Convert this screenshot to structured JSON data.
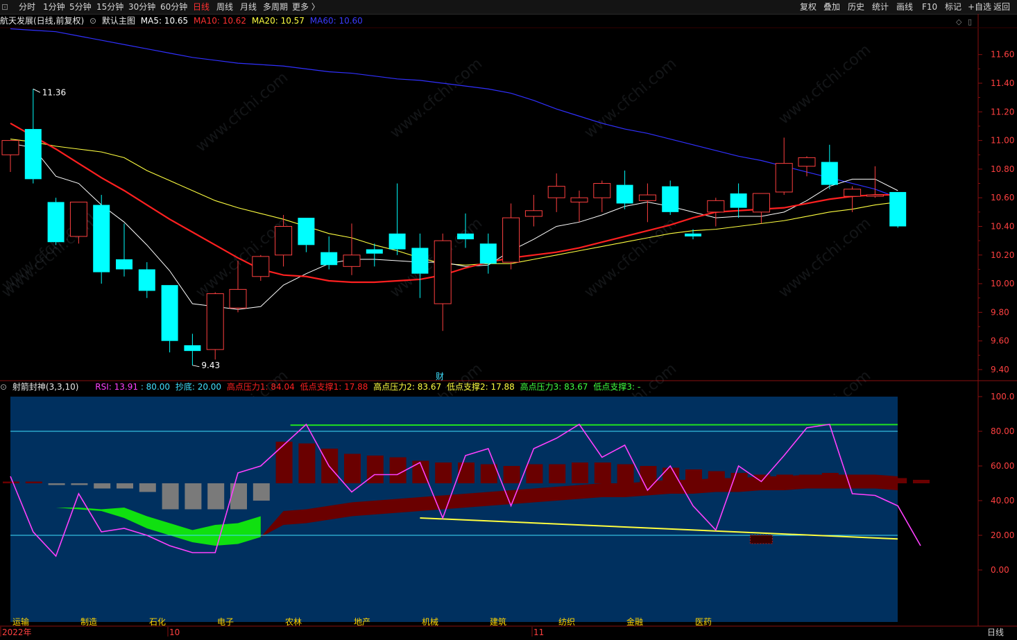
{
  "toolbar": {
    "left": [
      "分时",
      "1分钟",
      "5分钟",
      "15分钟",
      "30分钟",
      "60分钟",
      "日线",
      "周线",
      "月线",
      "多周期",
      "更多 〉"
    ],
    "active": "日线",
    "right": [
      "复权",
      "叠加",
      "历史",
      "统计",
      "画线",
      "F10",
      "标记",
      "+自选",
      "返回"
    ]
  },
  "main": {
    "stock": "航天发展(日线,前复权)",
    "template": "默认主图",
    "ma5": "MA5: 10.65",
    "ma10": "MA10: 10.62",
    "ma20": "MA20: 10.57",
    "ma60": "MA60: 10.60",
    "high_label": "11.36",
    "low_label": "9.43",
    "finance_marker": "财"
  },
  "sub": {
    "name": "射箭封神(3,3,10)",
    "rsi": "RSI: 13.91",
    "v80": ": 80.00",
    "chaodi": "抄底: 20.00",
    "gy1": "高点压力1: 84.04",
    "dz1": "低点支撑1: 17.88",
    "gy2": "高点压力2: 83.67",
    "dz2": "低点支撑2: 17.88",
    "gy3": "高点压力3: 83.67",
    "dz3": "低点支撑3: -"
  },
  "sectors": [
    "运输",
    "制造",
    "石化",
    "电子",
    "农林",
    "地产",
    "机械",
    "建筑",
    "纺织",
    "金融",
    "医药"
  ],
  "time_axis": [
    "2022年",
    "10",
    "11"
  ],
  "period_label": "日线",
  "watermark": "www.cfchi.com",
  "colors": {
    "up": "#ff4040",
    "down": "#00ffff",
    "ma5": "#ffffff",
    "ma10": "#ff2020",
    "ma20": "#ffff40",
    "ma60": "#3030ff",
    "rsi": "#ff40ff",
    "subbg": "#00305f"
  },
  "chart_data": [
    {
      "type": "candlestick",
      "title": "航天发展(日线,前复权)",
      "y_ticks": [
        "11.60",
        "11.40",
        "11.20",
        "11.00",
        "10.80",
        "10.60",
        "10.40",
        "10.20",
        "10.00",
        "9.80",
        "9.60",
        "9.40"
      ],
      "ylim": [
        9.37,
        11.85
      ],
      "candles": [
        {
          "o": 10.9,
          "h": 11.0,
          "l": 10.78,
          "c": 11.0
        },
        {
          "o": 11.08,
          "h": 11.36,
          "l": 10.7,
          "c": 10.73
        },
        {
          "o": 10.57,
          "h": 10.6,
          "l": 10.27,
          "c": 10.29
        },
        {
          "o": 10.33,
          "h": 10.57,
          "l": 10.28,
          "c": 10.57
        },
        {
          "o": 10.55,
          "h": 10.62,
          "l": 10.0,
          "c": 10.08
        },
        {
          "o": 10.17,
          "h": 10.42,
          "l": 10.05,
          "c": 10.1
        },
        {
          "o": 10.1,
          "h": 10.15,
          "l": 9.9,
          "c": 9.95
        },
        {
          "o": 9.99,
          "h": 9.99,
          "l": 9.52,
          "c": 9.6
        },
        {
          "o": 9.57,
          "h": 9.65,
          "l": 9.43,
          "c": 9.53
        },
        {
          "o": 9.54,
          "h": 9.94,
          "l": 9.47,
          "c": 9.93
        },
        {
          "o": 9.83,
          "h": 10.16,
          "l": 9.8,
          "c": 9.96
        },
        {
          "o": 10.05,
          "h": 10.2,
          "l": 10.02,
          "c": 10.19
        },
        {
          "o": 10.2,
          "h": 10.48,
          "l": 10.12,
          "c": 10.4
        },
        {
          "o": 10.46,
          "h": 10.46,
          "l": 10.22,
          "c": 10.27
        },
        {
          "o": 10.22,
          "h": 10.33,
          "l": 10.1,
          "c": 10.13
        },
        {
          "o": 10.12,
          "h": 10.42,
          "l": 10.06,
          "c": 10.2
        },
        {
          "o": 10.24,
          "h": 10.28,
          "l": 10.12,
          "c": 10.21
        },
        {
          "o": 10.35,
          "h": 10.7,
          "l": 10.2,
          "c": 10.24
        },
        {
          "o": 10.25,
          "h": 10.35,
          "l": 9.9,
          "c": 10.07
        },
        {
          "o": 9.86,
          "h": 10.35,
          "l": 9.67,
          "c": 10.3
        },
        {
          "o": 10.35,
          "h": 10.49,
          "l": 10.25,
          "c": 10.31
        },
        {
          "o": 10.28,
          "h": 10.35,
          "l": 10.07,
          "c": 10.14
        },
        {
          "o": 10.15,
          "h": 10.56,
          "l": 10.1,
          "c": 10.46
        },
        {
          "o": 10.47,
          "h": 10.62,
          "l": 10.4,
          "c": 10.51
        },
        {
          "o": 10.6,
          "h": 10.77,
          "l": 10.5,
          "c": 10.68
        },
        {
          "o": 10.57,
          "h": 10.65,
          "l": 10.43,
          "c": 10.6
        },
        {
          "o": 10.6,
          "h": 10.72,
          "l": 10.5,
          "c": 10.7
        },
        {
          "o": 10.69,
          "h": 10.79,
          "l": 10.52,
          "c": 10.56
        },
        {
          "o": 10.58,
          "h": 10.7,
          "l": 10.43,
          "c": 10.62
        },
        {
          "o": 10.68,
          "h": 10.72,
          "l": 10.48,
          "c": 10.5
        },
        {
          "o": 10.35,
          "h": 10.38,
          "l": 10.31,
          "c": 10.33
        },
        {
          "o": 10.5,
          "h": 10.6,
          "l": 10.4,
          "c": 10.58
        },
        {
          "o": 10.63,
          "h": 10.7,
          "l": 10.46,
          "c": 10.53
        },
        {
          "o": 10.5,
          "h": 10.63,
          "l": 10.42,
          "c": 10.63
        },
        {
          "o": 10.64,
          "h": 11.02,
          "l": 10.62,
          "c": 10.84
        },
        {
          "o": 10.82,
          "h": 10.89,
          "l": 10.75,
          "c": 10.88
        },
        {
          "o": 10.85,
          "h": 10.97,
          "l": 10.66,
          "c": 10.69
        },
        {
          "o": 10.61,
          "h": 10.68,
          "l": 10.5,
          "c": 10.66
        },
        {
          "o": 10.62,
          "h": 10.82,
          "l": 10.6,
          "c": 10.62
        },
        {
          "o": 10.64,
          "h": 10.64,
          "l": 10.39,
          "c": 10.4
        }
      ],
      "ma5": [
        10.98,
        10.95,
        10.75,
        10.7,
        10.55,
        10.43,
        10.27,
        10.09,
        9.86,
        9.84,
        9.82,
        9.84,
        9.99,
        10.07,
        10.14,
        10.17,
        10.17,
        10.16,
        10.15,
        10.15,
        10.12,
        10.13,
        10.23,
        10.31,
        10.4,
        10.43,
        10.48,
        10.54,
        10.57,
        10.54,
        10.5,
        10.46,
        10.47,
        10.47,
        10.5,
        10.58,
        10.68,
        10.73,
        10.73,
        10.65
      ],
      "ma10": [
        11.12,
        11.03,
        10.94,
        10.84,
        10.74,
        10.65,
        10.55,
        10.45,
        10.36,
        10.27,
        10.18,
        10.1,
        10.06,
        10.05,
        10.02,
        10.01,
        10.01,
        10.02,
        10.03,
        10.06,
        10.11,
        10.15,
        10.18,
        10.2,
        10.22,
        10.25,
        10.29,
        10.33,
        10.37,
        10.41,
        10.46,
        10.5,
        10.51,
        10.52,
        10.53,
        10.56,
        10.59,
        10.61,
        10.62,
        10.62
      ],
      "ma20": [
        11.01,
        10.99,
        10.96,
        10.94,
        10.92,
        10.88,
        10.79,
        10.72,
        10.65,
        10.58,
        10.53,
        10.49,
        10.45,
        10.4,
        10.35,
        10.32,
        10.27,
        10.23,
        10.18,
        10.14,
        10.13,
        10.14,
        10.14,
        10.17,
        10.2,
        10.23,
        10.26,
        10.29,
        10.32,
        10.35,
        10.37,
        10.38,
        10.4,
        10.42,
        10.44,
        10.47,
        10.5,
        10.52,
        10.55,
        10.57
      ],
      "ma60": [
        11.78,
        11.77,
        11.76,
        11.73,
        11.7,
        11.67,
        11.64,
        11.61,
        11.58,
        11.56,
        11.54,
        11.53,
        11.52,
        11.5,
        11.48,
        11.47,
        11.45,
        11.43,
        11.42,
        11.4,
        11.38,
        11.36,
        11.33,
        11.28,
        11.22,
        11.17,
        11.12,
        11.08,
        11.05,
        11.01,
        10.97,
        10.93,
        10.89,
        10.86,
        10.82,
        10.78,
        10.74,
        10.7,
        10.66,
        10.6
      ]
    },
    {
      "type": "line",
      "title": "射箭封神(3,3,10)",
      "y_ticks": [
        "100.0",
        "80.00",
        "60.00",
        "40.00",
        "20.00",
        "0.00"
      ],
      "ylim": [
        -20,
        100
      ],
      "rsi": [
        54,
        22,
        8,
        44,
        22,
        24,
        20,
        14,
        10,
        10,
        56,
        60,
        72,
        84,
        60,
        45,
        55,
        55,
        62,
        30,
        66,
        70,
        37,
        70,
        76,
        84,
        65,
        72,
        46,
        60,
        37,
        23,
        60,
        51,
        66,
        82,
        84,
        44,
        43,
        37,
        14
      ],
      "reference_lines": [
        80,
        20
      ],
      "high_pressure": 84.04,
      "low_support": 17.88,
      "histogram": [
        1,
        1,
        -1,
        -1,
        -3,
        -3,
        -5,
        -15,
        -15,
        -15,
        -15,
        -10,
        24,
        23,
        20,
        17,
        16,
        15,
        13,
        12,
        12,
        11,
        10,
        11,
        11,
        12,
        12,
        11,
        10,
        9,
        8,
        7,
        6,
        5,
        5,
        5,
        6,
        5,
        4,
        3,
        2
      ],
      "band_bottom": [
        36,
        36,
        36,
        35,
        34,
        30,
        24,
        20,
        16,
        14,
        15,
        19,
        30,
        31,
        33,
        35,
        36,
        37,
        38,
        39,
        40,
        41,
        42,
        43,
        44,
        45,
        46,
        46,
        47,
        48,
        48,
        49,
        49,
        50,
        50,
        51,
        51,
        51,
        51,
        50,
        50
      ]
    }
  ]
}
